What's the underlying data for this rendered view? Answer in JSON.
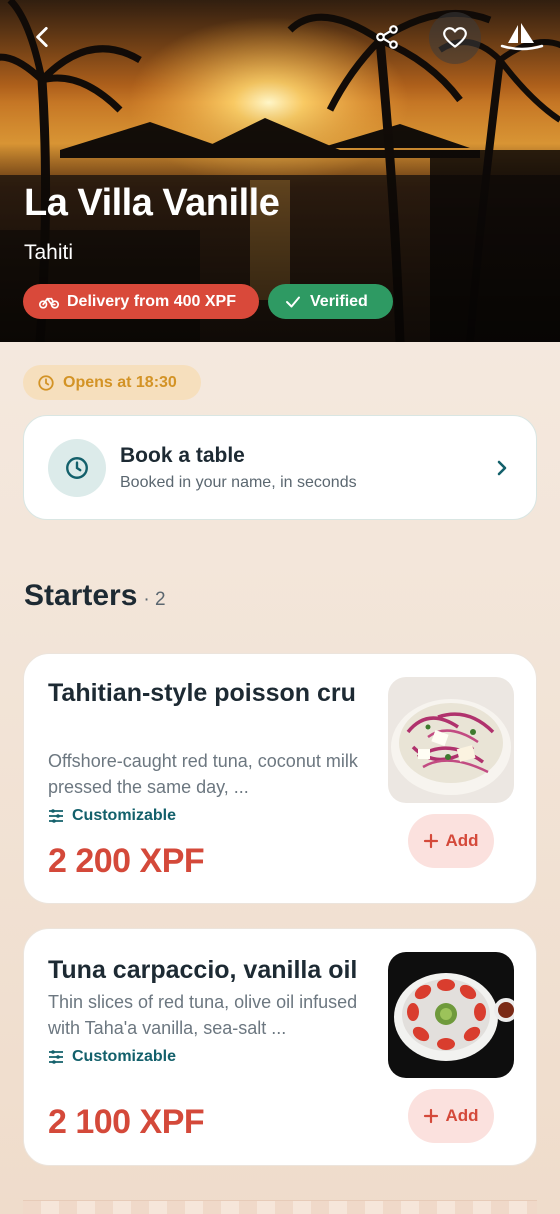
{
  "restaurant": {
    "name": "La Villa Vanille",
    "location": "Tahiti"
  },
  "badges": {
    "delivery": "Delivery from 400 XPF",
    "verified": "Verified"
  },
  "status": {
    "opens": "Opens at 18:30"
  },
  "booking": {
    "title": "Book a table",
    "subtitle": "Booked in your name, in seconds"
  },
  "section": {
    "title": "Starters",
    "count": "· 2"
  },
  "dishes": [
    {
      "name": "Tahitian-style poisson cru",
      "description": "Offshore-caught red tuna, coconut milk pressed the same day, ...",
      "customizable": "Customizable",
      "price": "2 200 XPF",
      "add_label": "Add"
    },
    {
      "name": "Tuna carpaccio, vanilla oil",
      "description": "Thin slices of red tuna, olive oil infused with Taha'a vanilla, sea-salt ...",
      "customizable": "Customizable",
      "price": "2 100 XPF",
      "add_label": "Add"
    }
  ],
  "icons": {
    "back": "back-arrow-icon",
    "share": "share-icon",
    "favorite": "heart-icon",
    "logo": "sailboat-logo-icon",
    "bike": "bike-icon",
    "check": "check-icon",
    "clock": "clock-icon",
    "chevron": "chevron-right-icon",
    "sliders": "sliders-icon",
    "plus": "plus-icon"
  },
  "colors": {
    "accent_red": "#d4493a",
    "verified_green": "#2e9a63",
    "teal": "#13606b",
    "amber": "#d39325"
  }
}
